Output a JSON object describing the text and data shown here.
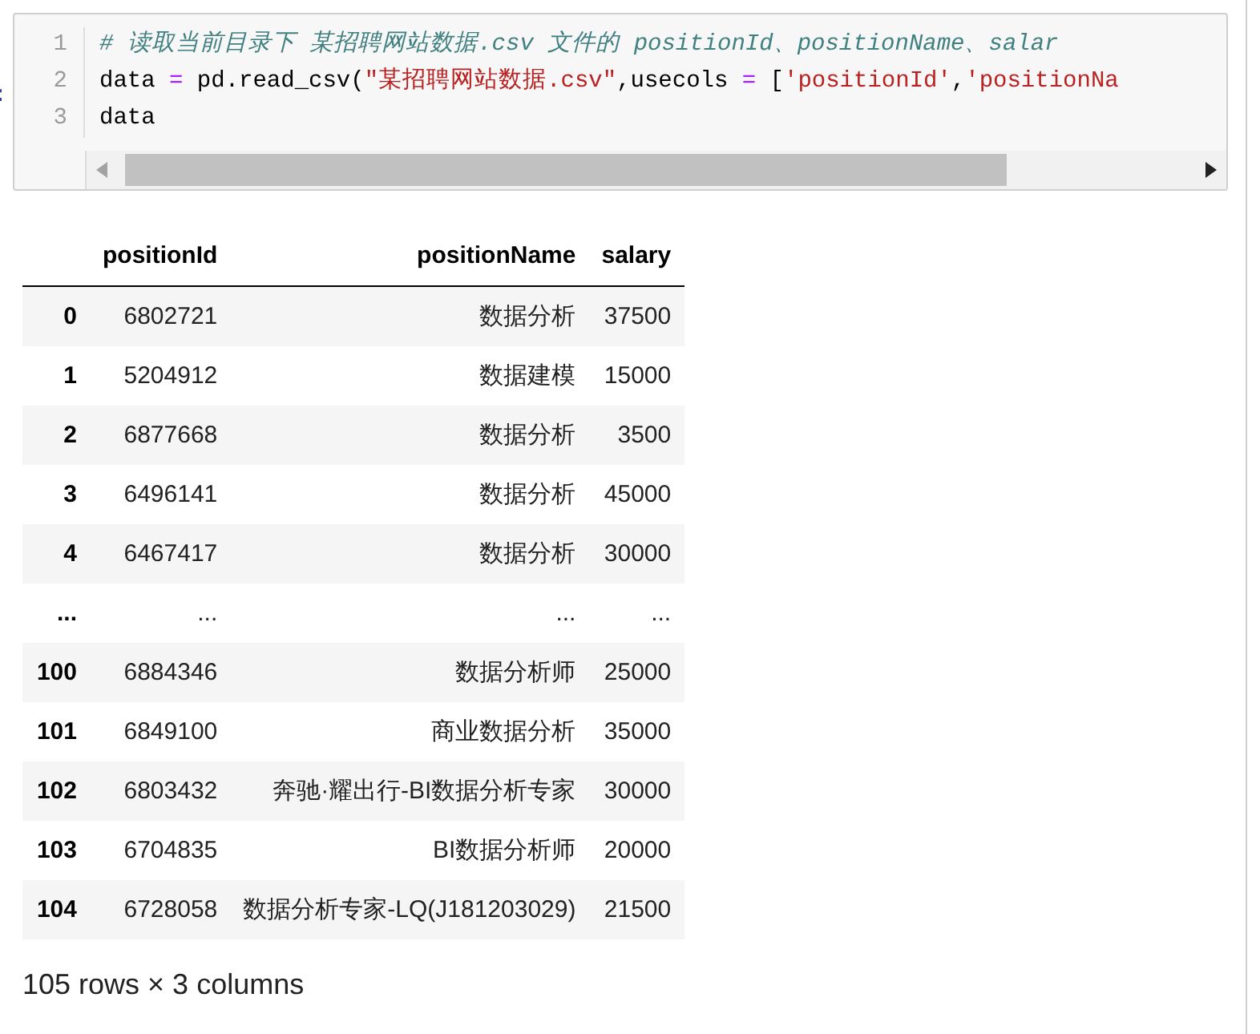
{
  "cell": {
    "prompt": ":",
    "code_lines": [
      {
        "number": "1",
        "tokens": [
          {
            "kind": "comment",
            "text": "# 读取当前目录下 某招聘网站数据.csv 文件的 positionId、positionName、salar"
          }
        ]
      },
      {
        "number": "2",
        "tokens": [
          {
            "kind": "name",
            "text": "data "
          },
          {
            "kind": "operator",
            "text": "="
          },
          {
            "kind": "name",
            "text": " pd.read_csv("
          },
          {
            "kind": "string",
            "text": "\"某招聘网站数据.csv\""
          },
          {
            "kind": "name",
            "text": ",usecols "
          },
          {
            "kind": "operator",
            "text": "="
          },
          {
            "kind": "name",
            "text": " ["
          },
          {
            "kind": "string",
            "text": "'positionId'"
          },
          {
            "kind": "name",
            "text": ","
          },
          {
            "kind": "string",
            "text": "'positionNa"
          }
        ]
      },
      {
        "number": "3",
        "tokens": [
          {
            "kind": "name",
            "text": "data"
          }
        ]
      }
    ]
  },
  "table": {
    "columns": [
      "positionId",
      "positionName",
      "salary"
    ],
    "rows": [
      {
        "index": "0",
        "cells": [
          "6802721",
          "数据分析",
          "37500"
        ]
      },
      {
        "index": "1",
        "cells": [
          "5204912",
          "数据建模",
          "15000"
        ]
      },
      {
        "index": "2",
        "cells": [
          "6877668",
          "数据分析",
          "3500"
        ]
      },
      {
        "index": "3",
        "cells": [
          "6496141",
          "数据分析",
          "45000"
        ]
      },
      {
        "index": "4",
        "cells": [
          "6467417",
          "数据分析",
          "30000"
        ]
      },
      {
        "index": "...",
        "cells": [
          "...",
          "...",
          "..."
        ]
      },
      {
        "index": "100",
        "cells": [
          "6884346",
          "数据分析师",
          "25000"
        ]
      },
      {
        "index": "101",
        "cells": [
          "6849100",
          "商业数据分析",
          "35000"
        ]
      },
      {
        "index": "102",
        "cells": [
          "6803432",
          "奔驰·耀出行-BI数据分析专家",
          "30000"
        ]
      },
      {
        "index": "103",
        "cells": [
          "6704835",
          "BI数据分析师",
          "20000"
        ]
      },
      {
        "index": "104",
        "cells": [
          "6728058",
          "数据分析专家-LQ(J181203029)",
          "21500"
        ]
      }
    ]
  },
  "footer": "105 rows × 3 columns"
}
